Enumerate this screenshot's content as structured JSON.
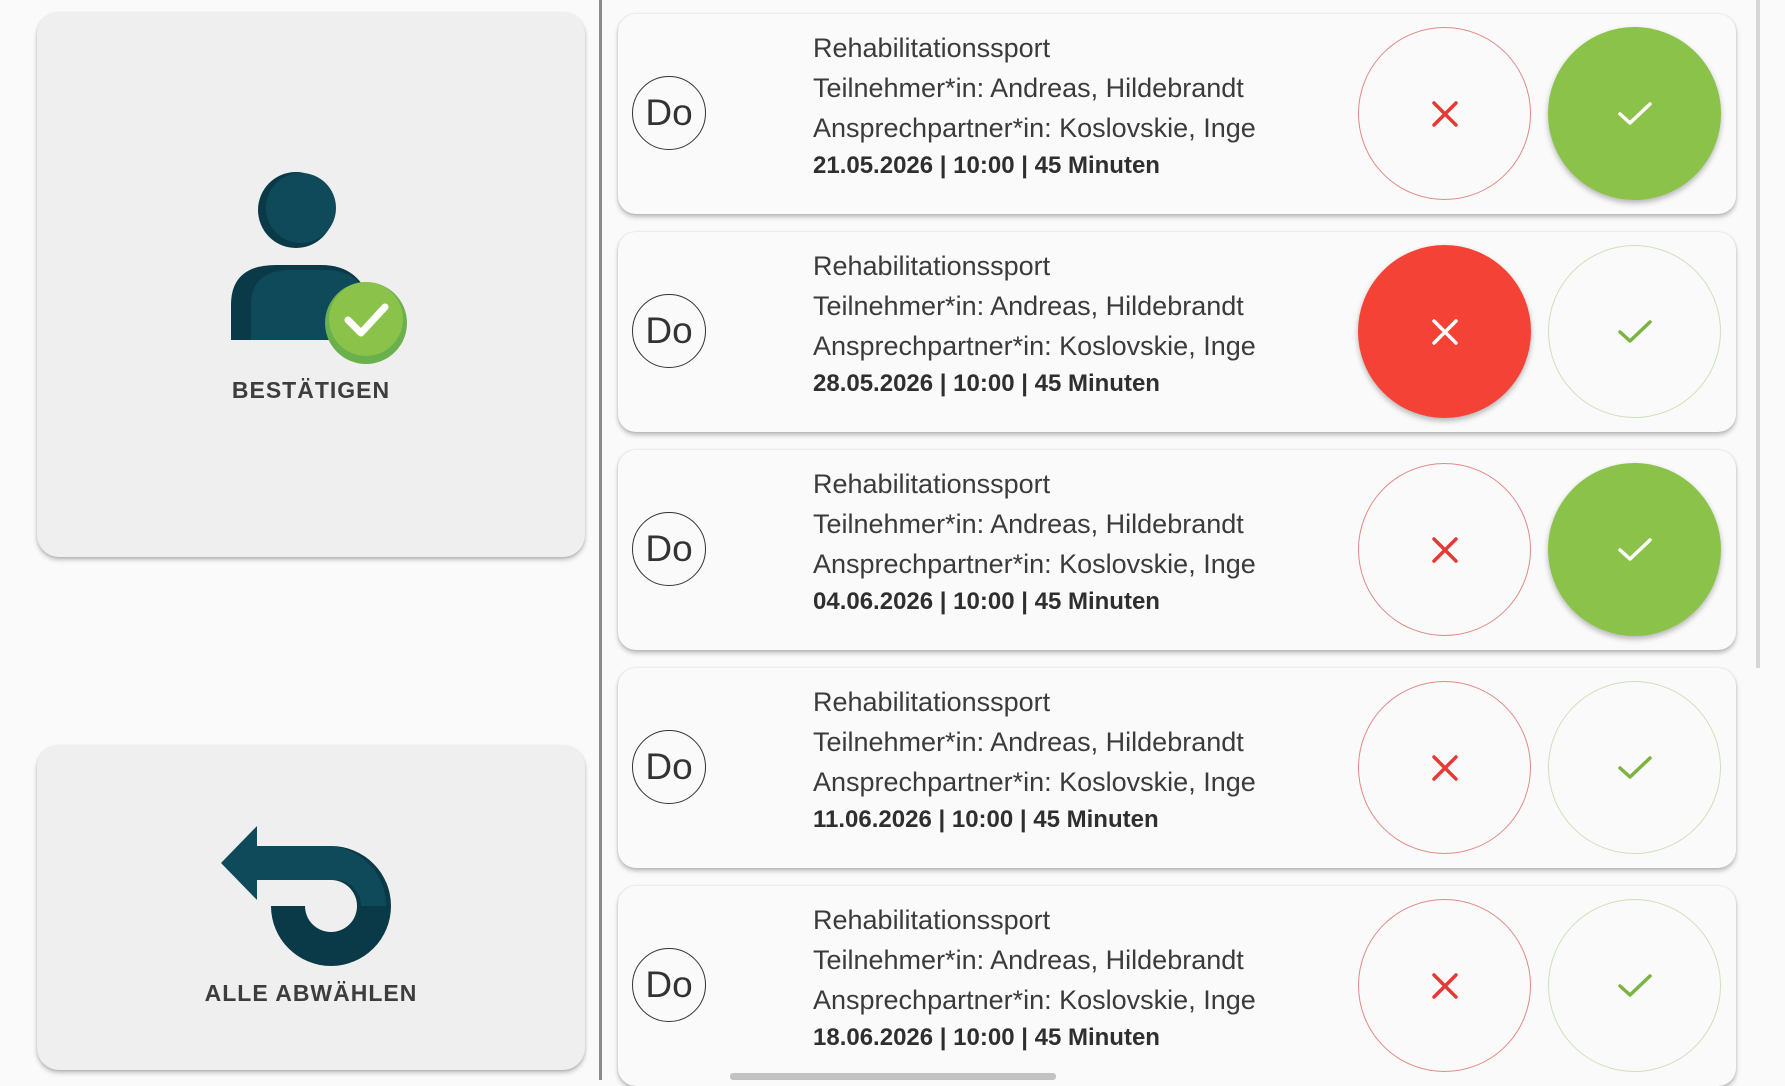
{
  "actions": {
    "confirm": {
      "label": "BESTÄTIGEN",
      "icon": "user-check-icon"
    },
    "deselect_all": {
      "label": "ALLE ABWÄHLEN",
      "icon": "undo-arrow-icon"
    }
  },
  "colors": {
    "primary_dark": "#0f4a5a",
    "accept_green": "#8bc34a",
    "reject_red": "#f44336"
  },
  "appointments": [
    {
      "day": "Do",
      "title": "Rehabilitationssport",
      "participant": "Teilnehmer*in: Andreas, Hildebrandt",
      "contact": "Ansprechpartner*in: Koslovskie, Inge",
      "meta": "21.05.2026 | 10:00 | 45 Minuten",
      "status": "accepted"
    },
    {
      "day": "Do",
      "title": "Rehabilitationssport",
      "participant": "Teilnehmer*in: Andreas, Hildebrandt",
      "contact": "Ansprechpartner*in: Koslovskie, Inge",
      "meta": "28.05.2026 | 10:00 | 45 Minuten",
      "status": "rejected"
    },
    {
      "day": "Do",
      "title": "Rehabilitationssport",
      "participant": "Teilnehmer*in: Andreas, Hildebrandt",
      "contact": "Ansprechpartner*in: Koslovskie, Inge",
      "meta": "04.06.2026 | 10:00 | 45 Minuten",
      "status": "accepted"
    },
    {
      "day": "Do",
      "title": "Rehabilitationssport",
      "participant": "Teilnehmer*in: Andreas, Hildebrandt",
      "contact": "Ansprechpartner*in: Koslovskie, Inge",
      "meta": "11.06.2026 | 10:00 | 45 Minuten",
      "status": "none"
    },
    {
      "day": "Do",
      "title": "Rehabilitationssport",
      "participant": "Teilnehmer*in: Andreas, Hildebrandt",
      "contact": "Ansprechpartner*in: Koslovskie, Inge",
      "meta": "18.06.2026 | 10:00 | 45 Minuten",
      "status": "none"
    }
  ]
}
